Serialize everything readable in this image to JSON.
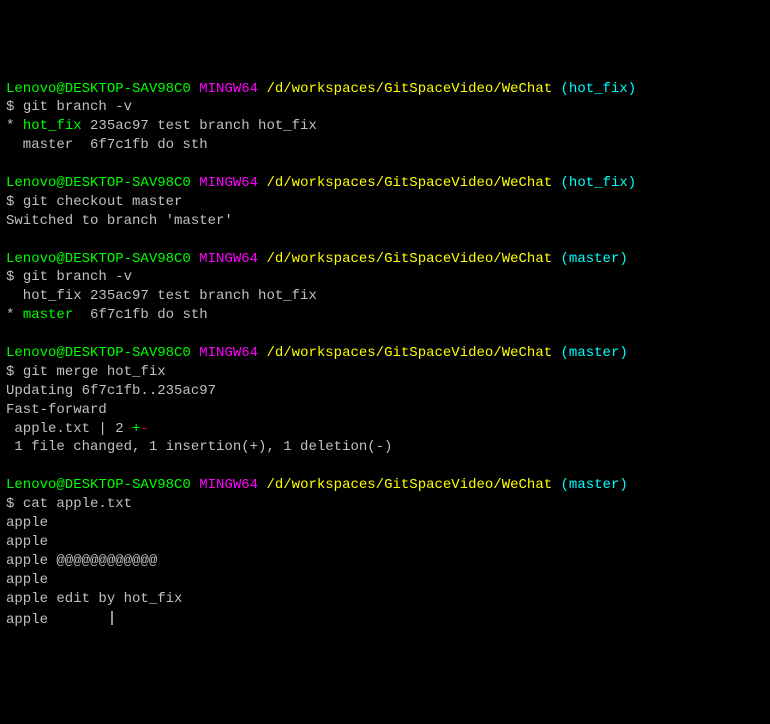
{
  "prompt_user_host": "Lenovo@DESKTOP-SAV98C0",
  "prompt_env": "MINGW64",
  "prompt_path": "/d/workspaces/GitSpaceVideo/WeChat",
  "branch_hotfix": "(hot_fix)",
  "branch_master": "(master)",
  "dollar": "$",
  "blocks": [
    {
      "cmd": "git branch -v",
      "branch": "hotfix",
      "out": [
        {
          "pre": "* ",
          "name": "hot_fix",
          "rest": " 235ac97 test branch hot_fix",
          "current": true
        },
        {
          "pre": "  ",
          "name": "master ",
          "rest": " 6f7c1fb do sth",
          "current": false
        }
      ]
    },
    {
      "cmd": "git checkout master",
      "branch": "hotfix",
      "out_plain": [
        "Switched to branch 'master'"
      ]
    },
    {
      "cmd": "git branch -v",
      "branch": "master",
      "out": [
        {
          "pre": "  ",
          "name": "hot_fix",
          "rest": " 235ac97 test branch hot_fix",
          "current": false
        },
        {
          "pre": "* ",
          "name": "master ",
          "rest": " 6f7c1fb do sth",
          "current": true
        }
      ]
    },
    {
      "cmd": "git merge hot_fix",
      "branch": "master",
      "merge": {
        "l1": "Updating 6f7c1fb..235ac97",
        "l2": "Fast-forward",
        "file": " apple.txt | 2 ",
        "plus": "+",
        "minus": "-",
        "summary": " 1 file changed, 1 insertion(+), 1 deletion(-)"
      }
    },
    {
      "cmd": "cat apple.txt",
      "branch": "master",
      "out_plain": [
        "apple",
        "apple",
        "apple @@@@@@@@@@@@",
        "apple",
        "apple edit by hot_fix",
        "apple"
      ]
    }
  ]
}
